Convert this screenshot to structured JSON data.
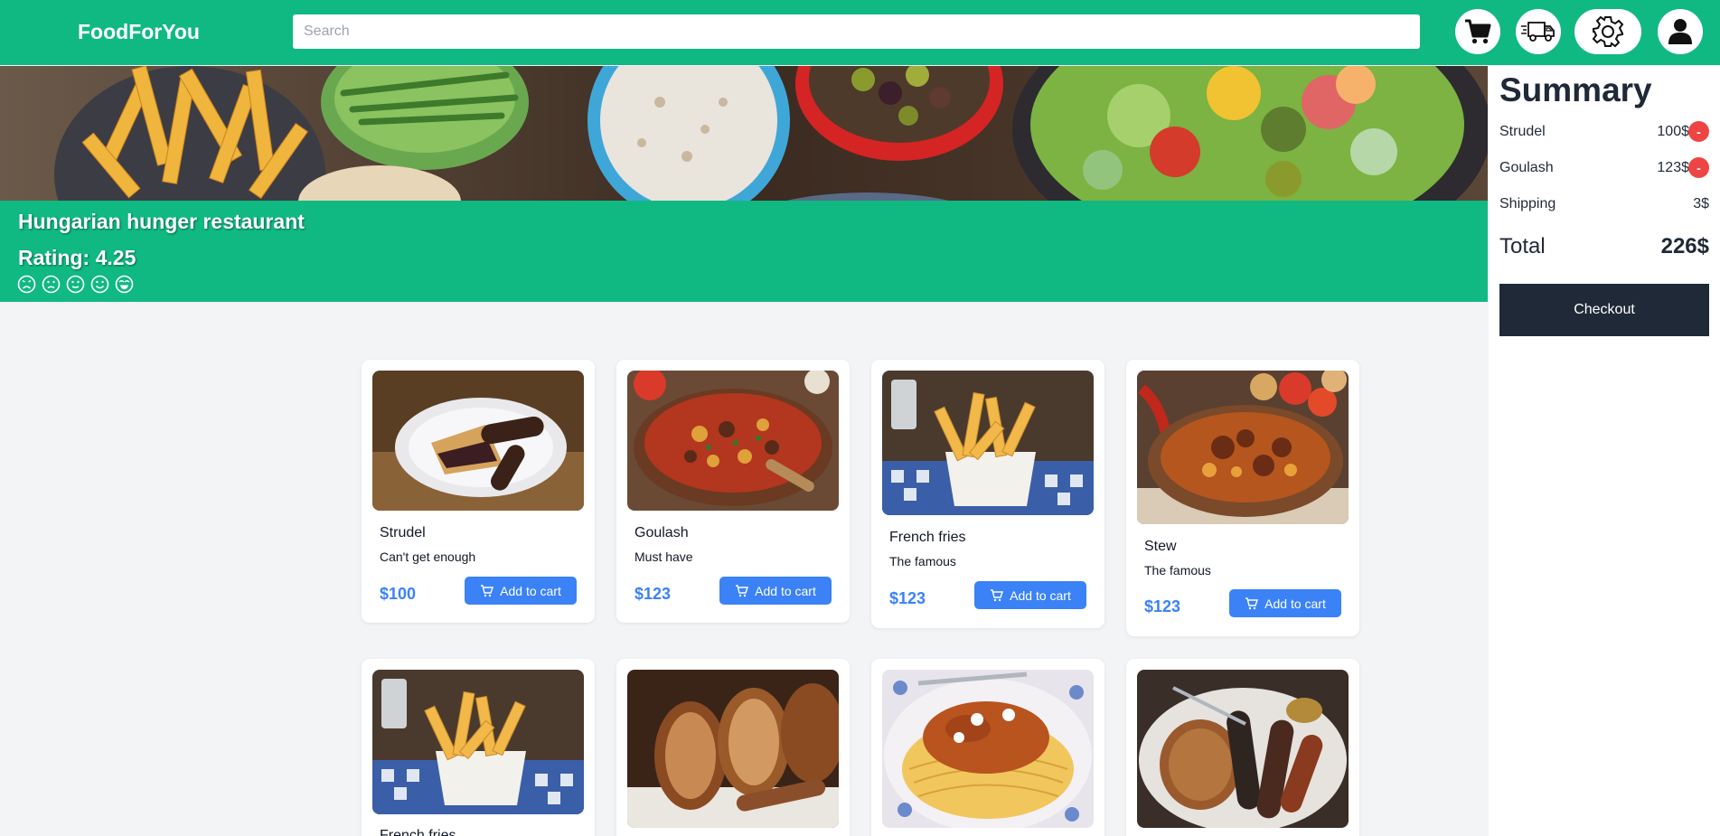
{
  "header": {
    "brand": "FoodForYou",
    "search_placeholder": "Search",
    "icons": [
      "cart-icon",
      "delivery-truck-icon",
      "gear-icon",
      "user-icon"
    ]
  },
  "restaurant": {
    "name": "Hungarian hunger restaurant",
    "rating_text": "Rating: 4.25",
    "rating_faces": [
      "frown-face-icon",
      "sad-face-icon",
      "neutral-face-icon",
      "smile-face-icon",
      "grin-face-icon"
    ]
  },
  "summary": {
    "title": "Summary",
    "items": [
      {
        "name": "Strudel",
        "price": "100$",
        "remove_label": "-"
      },
      {
        "name": "Goulash",
        "price": "123$",
        "remove_label": "-"
      }
    ],
    "shipping_label": "Shipping",
    "shipping_value": "3$",
    "total_label": "Total",
    "total_value": "226$",
    "checkout_label": "Checkout"
  },
  "menu": [
    {
      "name": "Strudel",
      "description": "Can't get enough",
      "price": "$100",
      "button": "Add to cart"
    },
    {
      "name": "Goulash",
      "description": "Must have",
      "price": "$123",
      "button": "Add to cart"
    },
    {
      "name": "French fries",
      "description": "The famous",
      "price": "$123",
      "button": "Add to cart"
    },
    {
      "name": "Stew",
      "description": "The famous",
      "price": "$123",
      "button": "Add to cart"
    },
    {
      "name": "French fries"
    }
  ],
  "colors": {
    "accent": "#10b981",
    "primary_button": "#3b82f6",
    "dark": "#1f2937",
    "danger": "#ef4444",
    "background": "#f3f4f6"
  }
}
